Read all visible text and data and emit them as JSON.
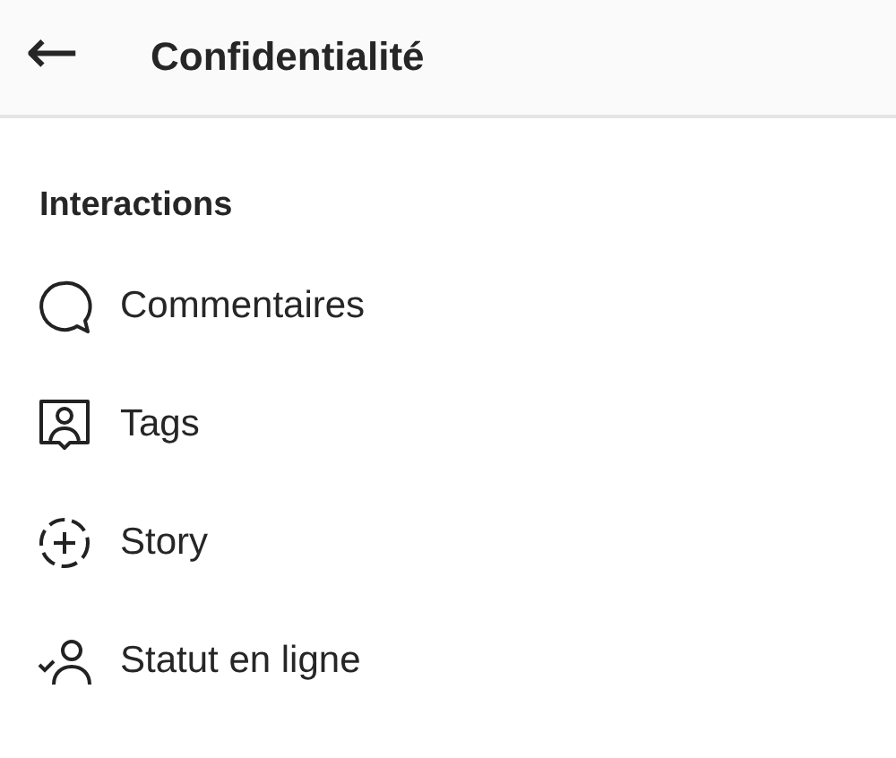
{
  "header": {
    "back_icon": "←",
    "title": "Confidentialité"
  },
  "section": {
    "title": "Interactions",
    "items": [
      {
        "kind": "comment",
        "label": "Commentaires"
      },
      {
        "kind": "tag",
        "label": "Tags"
      },
      {
        "kind": "story",
        "label": "Story"
      },
      {
        "kind": "status",
        "label": "Statut en ligne"
      }
    ]
  }
}
